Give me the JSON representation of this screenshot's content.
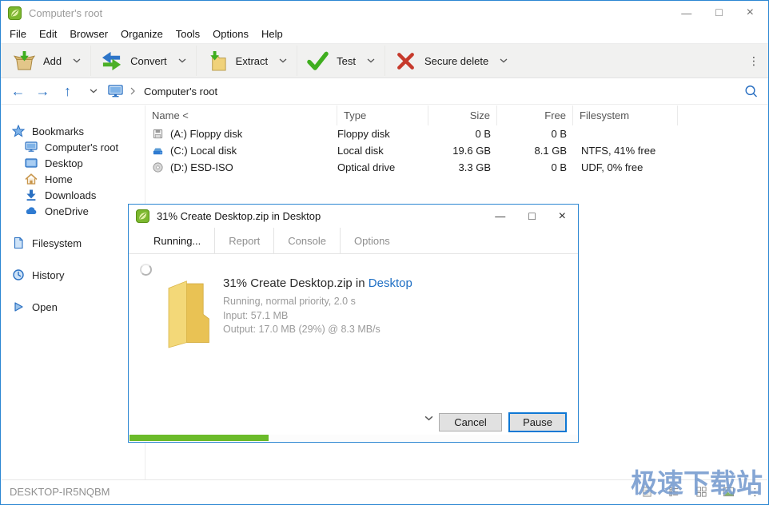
{
  "window": {
    "title": "Computer's root"
  },
  "menu": {
    "items": [
      "File",
      "Edit",
      "Browser",
      "Organize",
      "Tools",
      "Options",
      "Help"
    ]
  },
  "toolbar": {
    "buttons": [
      {
        "label": "Add"
      },
      {
        "label": "Convert"
      },
      {
        "label": "Extract"
      },
      {
        "label": "Test"
      },
      {
        "label": "Secure delete"
      }
    ]
  },
  "navbar": {
    "breadcrumb": "Computer's root"
  },
  "sidebar": {
    "sections": [
      {
        "label": "Bookmarks",
        "children": [
          "Computer's root",
          "Desktop",
          "Home",
          "Downloads",
          "OneDrive"
        ]
      },
      {
        "label": "Filesystem"
      },
      {
        "label": "History"
      },
      {
        "label": "Open"
      }
    ]
  },
  "filelist": {
    "headers": {
      "name": "Name <",
      "type": "Type",
      "size": "Size",
      "free": "Free",
      "filesystem": "Filesystem"
    },
    "rows": [
      {
        "name": "(A:) Floppy disk",
        "type": "Floppy disk",
        "size": "0 B",
        "free": "0 B",
        "filesystem": ""
      },
      {
        "name": "(C:) Local disk",
        "type": "Local disk",
        "size": "19.6 GB",
        "free": "8.1 GB",
        "filesystem": "NTFS, 41% free"
      },
      {
        "name": "(D:) ESD-ISO",
        "type": "Optical drive",
        "size": "3.3 GB",
        "free": "0 B",
        "filesystem": "UDF, 0% free"
      }
    ]
  },
  "dialog": {
    "title": "31% Create Desktop.zip in Desktop",
    "tabs": [
      {
        "label": "Running..."
      },
      {
        "label": "Report"
      },
      {
        "label": "Console"
      },
      {
        "label": "Options"
      }
    ],
    "content": {
      "title_prefix": "31% Create Desktop.zip in ",
      "title_link": "Desktop",
      "status_line": "Running, normal priority, 2.0 s",
      "input_line": "Input: 57.1 MB",
      "output_line": "Output: 17.0 MB (29%) @ 8.3 MB/s"
    },
    "buttons": {
      "cancel": "Cancel",
      "pause": "Pause"
    },
    "progress_percent": 31
  },
  "statusbar": {
    "host": "DESKTOP-IR5NQBM"
  },
  "watermark": {
    "text": "极速下载站"
  },
  "glyphs": {
    "back": "←",
    "forward": "→",
    "up": "↑",
    "minimize": "—",
    "maximize": "□",
    "close": "×",
    "more": "⋮"
  },
  "colors": {
    "window_border": "#2b86d2",
    "accent_blue": "#2a70c2",
    "link_blue": "#1f6fc4",
    "progress_green": "#6bbb2a",
    "test_green": "#3fae1f",
    "delete_red": "#c6392b",
    "folder_yellow": "#e9c254",
    "toolbar_bg": "#f1f1f0"
  }
}
